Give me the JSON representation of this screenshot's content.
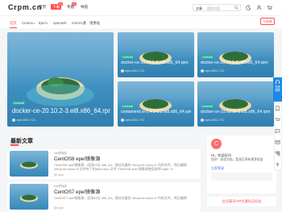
{
  "header": {
    "logo": "Crpm.cn",
    "nav": [
      "首页",
      "下载",
      "专题",
      "导航"
    ],
    "hot_badges": [
      "hot",
      "hot"
    ],
    "search": {
      "select": "文章",
      "placeholder": "搜索内容"
    }
  },
  "subnav": {
    "items": [
      "首页",
      "Centos",
      "Epel",
      "openssh",
      "mirrors源",
      "镜像站"
    ],
    "submit_label": "投稿"
  },
  "featured": {
    "big": {
      "category": "Centos8",
      "title": "docker-ce-20.10.2-3.el8.x86_64.rpm",
      "author": "crpm",
      "date": "2021-7-31"
    },
    "cards": [
      {
        "category": "Centos8",
        "title": "docker-ce-20.10.2-3.el8.x86_64.rpm",
        "author": "crpm",
        "date": "2021-7-31"
      },
      {
        "category": "Centos8",
        "title": "docker-ce-20.10.2-3.el8.x86_64.rpm",
        "author": "crpm",
        "date": "2021-7-31"
      },
      {
        "category": "Centos8",
        "title": "containerd.io-1.4.3-3.2.el8.x86_64.rpm",
        "author": "crpm",
        "date": "2021-7-31"
      },
      {
        "category": "Centos8",
        "title": "docker-ce-19.03.15-3.el8.x86_64.rpm",
        "author": "crpm",
        "date": "2021-7-31"
      }
    ]
  },
  "latest": {
    "title": "最新文章",
    "articles": [
      {
        "tag": "epel镜像源",
        "title": "CentOS8 epel镜像源",
        "desc": "CentOS8 epel镜像源，适用64位 x86_64，建议先备份 /etc/yum.repos.d/ 内的文件，然后编辑 /etc/yum.repos.d/ 文件夹下的epel.repo 文件 CentOS8 epel 镜像源使用说明 wget -O /etc/yum.repos.d/epel.repo http://mirrors.crpm.cn/...",
        "author": "crpm"
      },
      {
        "tag": "epel镜像源",
        "title": "CentOS7 epel镜像源",
        "desc": "CentOS7 epel镜像源，适用64位 x86_64，建议先备份 /etc/yum.repos.d/ 内的文件，然后编辑",
        "author": "crpm"
      }
    ]
  },
  "sidebar": {
    "avatar_char": "C",
    "greeting": "Hi，欢迎访问",
    "tip": "您好！欢迎光临，登录后享有更多权益",
    "login": "立即登录",
    "vip": "会员尊享VIP优惠购买权益"
  },
  "float": {
    "service": "在线客服"
  }
}
